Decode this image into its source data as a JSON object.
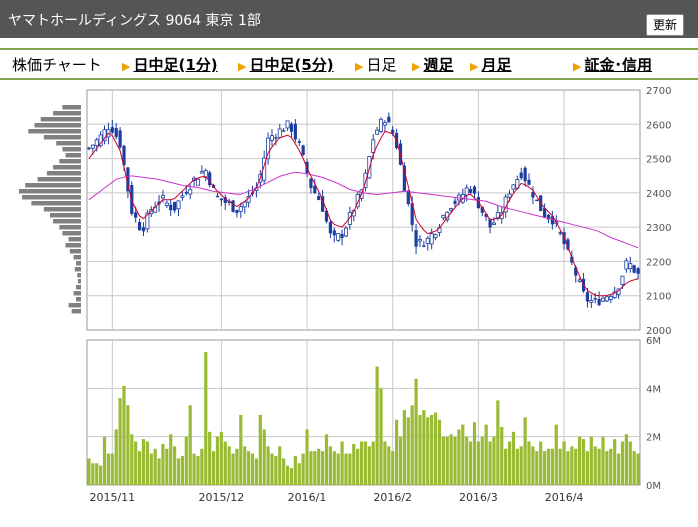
{
  "header": {
    "title": "ヤマトホールディングス 9064 東京 1部",
    "refresh_label": "更新"
  },
  "tabs": [
    {
      "label": "株価チャート",
      "link": false
    },
    {
      "label": "日中足(1分)",
      "link": true
    },
    {
      "label": "日中足(5分)",
      "link": true
    },
    {
      "label": "日足",
      "link": false
    },
    {
      "label": "週足",
      "link": true
    },
    {
      "label": "月足",
      "link": true
    },
    {
      "label": "証金･信用",
      "link": true
    }
  ],
  "colors": {
    "candle": "#1b3ea0",
    "ma_short": "#cc0033",
    "ma_long": "#cc33cc",
    "volume": "#99bb33",
    "profile": "#808080",
    "grid": "#c8c8c8",
    "tab_border": "#7da44a",
    "titlebar": "#555555"
  },
  "chart_data": [
    {
      "type": "candlestick",
      "ylim": [
        2000,
        2700
      ],
      "yticks": [
        "2000",
        "2100",
        "2200",
        "2300",
        "2400",
        "2500",
        "2600",
        "2700"
      ],
      "xticks": [
        "2015/11",
        "2015/12",
        "2016/1",
        "2016/2",
        "2016/3",
        "2016/4"
      ],
      "grid": true,
      "price_keypoints": [
        2530,
        2560,
        2600,
        2540,
        2350,
        2290,
        2360,
        2380,
        2350,
        2400,
        2440,
        2470,
        2390,
        2370,
        2350,
        2380,
        2420,
        2560,
        2580,
        2600,
        2530,
        2420,
        2370,
        2260,
        2280,
        2350,
        2420,
        2570,
        2620,
        2560,
        2400,
        2250,
        2260,
        2300,
        2360,
        2380,
        2420,
        2360,
        2300,
        2340,
        2420,
        2460,
        2400,
        2340,
        2320,
        2250,
        2170,
        2090,
        2080,
        2100,
        2120,
        2200,
        2160
      ],
      "ma_short_keypoints": [
        2500,
        2540,
        2580,
        2520,
        2380,
        2320,
        2350,
        2380,
        2380,
        2410,
        2440,
        2450,
        2410,
        2380,
        2360,
        2380,
        2420,
        2520,
        2560,
        2570,
        2520,
        2450,
        2390,
        2310,
        2300,
        2340,
        2410,
        2520,
        2580,
        2570,
        2450,
        2320,
        2280,
        2290,
        2330,
        2370,
        2400,
        2370,
        2320,
        2330,
        2390,
        2430,
        2410,
        2360,
        2330,
        2270,
        2190,
        2120,
        2100,
        2100,
        2110,
        2140,
        2150
      ],
      "ma_long_keypoints": [
        2380,
        2410,
        2440,
        2450,
        2445,
        2440,
        2430,
        2420,
        2415,
        2405,
        2400,
        2395,
        2410,
        2430,
        2450,
        2460,
        2455,
        2445,
        2430,
        2410,
        2400,
        2395,
        2400,
        2405,
        2400,
        2395,
        2390,
        2385,
        2380,
        2375,
        2360,
        2350,
        2340,
        2330,
        2320,
        2310,
        2300,
        2290,
        2270,
        2255,
        2240
      ],
      "volume_profile": [
        0.3,
        0.45,
        0.65,
        0.75,
        0.85,
        0.6,
        0.4,
        0.3,
        0.25,
        0.35,
        0.45,
        0.55,
        0.7,
        0.9,
        1.0,
        0.95,
        0.8,
        0.6,
        0.5,
        0.45,
        0.35,
        0.3,
        0.2,
        0.25,
        0.18,
        0.12,
        0.08,
        0.1,
        0.06,
        0.05,
        0.08,
        0.12,
        0.08,
        0.2,
        0.15
      ]
    },
    {
      "type": "bar",
      "ylim": [
        0,
        6
      ],
      "yticks": [
        "0M",
        "2M",
        "4M",
        "6M"
      ],
      "values": [
        1.1,
        0.9,
        0.9,
        0.8,
        2.0,
        1.3,
        1.3,
        2.3,
        3.6,
        4.1,
        3.3,
        2.1,
        1.8,
        1.4,
        1.9,
        1.8,
        1.3,
        1.5,
        1.1,
        1.7,
        1.5,
        2.1,
        1.6,
        1.1,
        1.2,
        2.0,
        3.3,
        1.3,
        1.2,
        1.5,
        5.5,
        2.2,
        1.4,
        2.0,
        2.2,
        1.8,
        1.6,
        1.3,
        1.5,
        2.9,
        1.6,
        1.4,
        1.3,
        1.1,
        2.9,
        2.3,
        1.6,
        1.3,
        1.2,
        1.6,
        1.1,
        0.8,
        0.7,
        1.2,
        0.9,
        1.3,
        2.3,
        1.4,
        1.4,
        1.5,
        1.4,
        2.1,
        1.6,
        1.4,
        1.3,
        1.8,
        1.3,
        1.3,
        1.7,
        1.5,
        1.8,
        1.8,
        1.6,
        1.8,
        4.9,
        4.0,
        1.8,
        1.6,
        1.4,
        2.7,
        2.0,
        3.1,
        2.8,
        3.3,
        4.4,
        2.9,
        3.1,
        2.8,
        2.9,
        3.0,
        2.7,
        2.0,
        2.0,
        2.1,
        2.0,
        2.3,
        2.5,
        2.0,
        1.8,
        2.6,
        1.8,
        2.0,
        2.5,
        1.8,
        2.0,
        3.5,
        2.4,
        1.5,
        1.8,
        2.2,
        1.5,
        1.6,
        2.8,
        1.8,
        1.6,
        1.4,
        1.8,
        1.4,
        1.5,
        1.5,
        2.5,
        1.5,
        1.8,
        1.4,
        1.6,
        1.5,
        2.0,
        1.9,
        1.4,
        2.0,
        1.6,
        1.5,
        2.0,
        1.4,
        1.5,
        1.9,
        1.3,
        1.8,
        2.1,
        1.8,
        1.4,
        1.3
      ]
    }
  ]
}
